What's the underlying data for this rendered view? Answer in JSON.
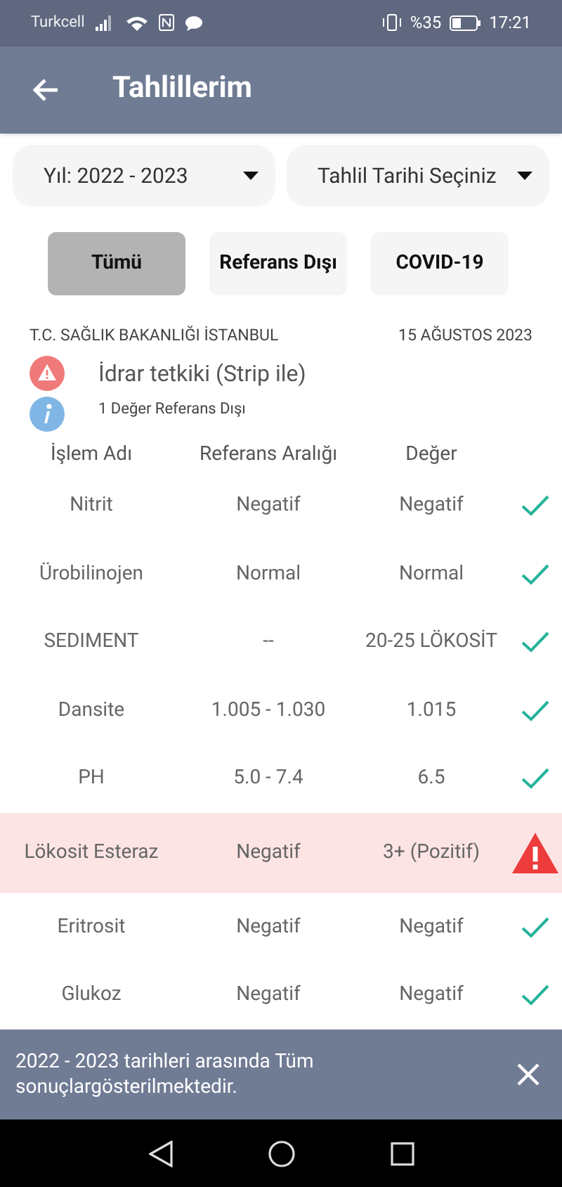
{
  "status_bar": {
    "carrier": "Turkcell",
    "battery": "%35",
    "time": "17:21"
  },
  "app_bar": {
    "title": "Tahlillerim"
  },
  "filters": [
    {
      "value": "Yıl: 2022 - 2023"
    },
    {
      "value": "Tahlil Tarihi Seçiniz"
    }
  ],
  "tabs": [
    {
      "label": "Tümü",
      "selected": true
    },
    {
      "label": "Referans Dışı",
      "selected": false
    },
    {
      "label": "COVID-19",
      "selected": false
    }
  ],
  "report": {
    "institution": "T.C. SAĞLIK BAKANLIĞI İSTANBUL",
    "date": "15 AĞUSTOS 2023",
    "title": "İdrar tetkiki (Strip ile)",
    "note": "1 Değer Referans Dışı",
    "has_warning": true
  },
  "table": {
    "columns": [
      "İşlem Adı",
      "Referans Aralığı",
      "Değer"
    ],
    "rows": [
      {
        "name": "Nitrit",
        "range": "Negatif",
        "value": "Negatif",
        "out_of_range": false
      },
      {
        "name": "Ürobilinojen",
        "range": "Normal",
        "value": "Normal",
        "out_of_range": false
      },
      {
        "name": "SEDIMENT",
        "range": "--",
        "value": "20-25 LÖKOSİT",
        "out_of_range": false
      },
      {
        "name": "Dansite",
        "range": "1.005 - 1.030",
        "value": "1.015",
        "out_of_range": false
      },
      {
        "name": "PH",
        "range": "5.0 - 7.4",
        "value": "6.5",
        "out_of_range": false
      },
      {
        "name": "Lökosit Esteraz",
        "range": "Negatif",
        "value": "3+ (Pozitif)",
        "out_of_range": true
      },
      {
        "name": "Eritrosit",
        "range": "Negatif",
        "value": "Negatif",
        "out_of_range": false
      },
      {
        "name": "Glukoz",
        "range": "Negatif",
        "value": "Negatif",
        "out_of_range": false
      }
    ]
  },
  "snackbar": {
    "message": "2022 - 2023 tarihleri arasında Tüm sonuçlargösterilmektedir."
  }
}
